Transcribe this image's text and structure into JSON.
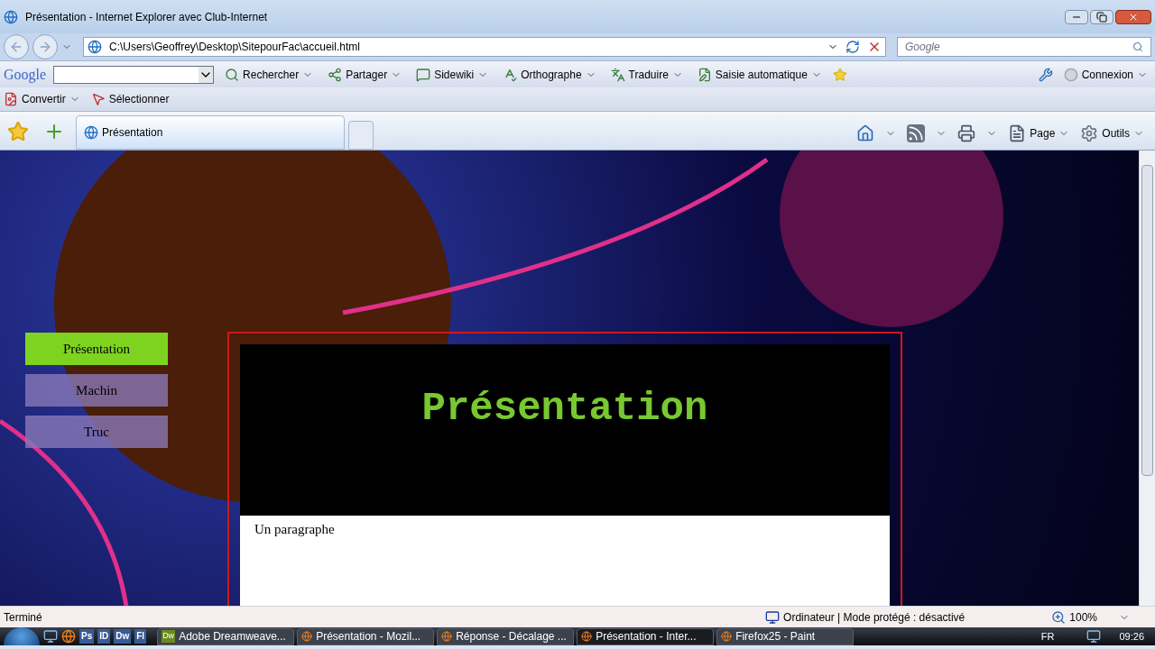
{
  "window": {
    "title": "Présentation - Internet Explorer avec Club-Internet"
  },
  "address": {
    "url": "C:\\Users\\Geoffrey\\Desktop\\SitepourFac\\accueil.html",
    "search_placeholder": "Google"
  },
  "google_toolbar": {
    "logo": "Google",
    "items": [
      {
        "label": "Rechercher",
        "kind": "menu"
      },
      {
        "label": "Partager",
        "kind": "menu"
      },
      {
        "label": "Sidewiki",
        "kind": "menu"
      },
      {
        "label": "Orthographe",
        "kind": "menu"
      },
      {
        "label": "Traduire",
        "kind": "menu"
      },
      {
        "label": "Saisie automatique",
        "kind": "menu"
      }
    ],
    "signin": "Connexion"
  },
  "pdf_toolbar": [
    "Convertir",
    "Sélectionner"
  ],
  "tabs": [
    {
      "label": "Présentation",
      "selected": true
    }
  ],
  "command_bar": [
    "Page",
    "Outils"
  ],
  "page": {
    "nav": [
      {
        "label": "Présentation",
        "selected": true
      },
      {
        "label": "Machin",
        "selected": false
      },
      {
        "label": "Truc",
        "selected": false
      }
    ],
    "heading": "Présentation",
    "paragraph": "Un paragraphe"
  },
  "status_bar": {
    "text": "Terminé",
    "zone": "Ordinateur | Mode protégé : désactivé",
    "zoom": "100%"
  },
  "taskbar": {
    "quick_launch": [
      "Ps",
      "ID",
      "Dw",
      "Fl"
    ],
    "buttons": [
      {
        "label": "Adobe Dreamweave...",
        "badge": "Dw",
        "selected": false
      },
      {
        "label": "Présentation - Mozil...",
        "selected": false
      },
      {
        "label": "Réponse - Décalage ...",
        "selected": false
      },
      {
        "label": "Présentation - Inter...",
        "selected": true
      },
      {
        "label": "Firefox25 - Paint",
        "selected": false
      }
    ],
    "language": "FR",
    "time": "09:26"
  }
}
